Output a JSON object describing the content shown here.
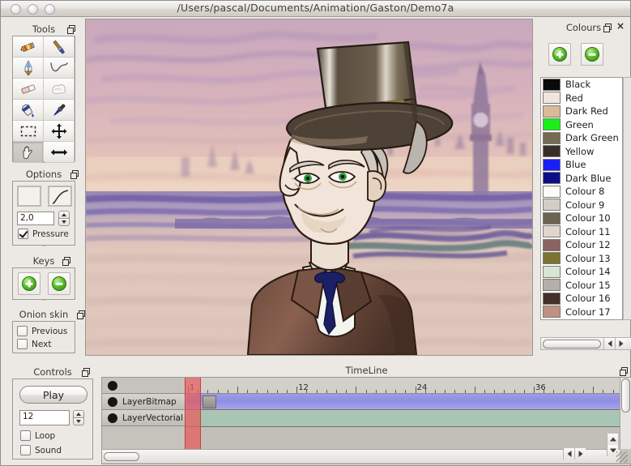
{
  "window": {
    "title": "/Users/pascal/Documents/Animation/Gaston/Demo7a",
    "traffic_lights": [
      "close",
      "minimize",
      "zoom"
    ]
  },
  "tools_palette": {
    "title": "Tools",
    "items": [
      {
        "name": "pencil-tool",
        "label": "Pencil",
        "selected": false
      },
      {
        "name": "brush-tool",
        "label": "Brush",
        "selected": false
      },
      {
        "name": "pen-tool",
        "label": "Pen",
        "selected": false
      },
      {
        "name": "polyline-tool",
        "label": "Polyline",
        "selected": false
      },
      {
        "name": "eraser-tool",
        "label": "Eraser",
        "selected": false
      },
      {
        "name": "smudge-tool",
        "label": "Smudge",
        "selected": false
      },
      {
        "name": "bucket-tool",
        "label": "Bucket",
        "selected": false
      },
      {
        "name": "eyedropper-tool",
        "label": "Eyedropper",
        "selected": false
      },
      {
        "name": "select-tool",
        "label": "Select",
        "selected": false
      },
      {
        "name": "move-tool",
        "label": "Move",
        "selected": false
      },
      {
        "name": "hand-tool",
        "label": "Hand",
        "selected": true
      },
      {
        "name": "resize-tool",
        "label": "Resize",
        "selected": false
      }
    ]
  },
  "options_palette": {
    "title": "Options",
    "color_swatch": "#000000",
    "curve_swatch": "#d7b340",
    "width_value": "2,0",
    "pressure_label": "Pressure",
    "pressure_checked": true
  },
  "keys_palette": {
    "title": "Keys",
    "add_label": "Add key",
    "remove_label": "Remove key"
  },
  "onion_palette": {
    "title": "Onion skin",
    "previous_label": "Previous",
    "previous_checked": false,
    "next_label": "Next",
    "next_checked": false
  },
  "controls_palette": {
    "title": "Controls",
    "play_label": "Play",
    "fps_value": "12",
    "loop_label": "Loop",
    "loop_checked": false,
    "sound_label": "Sound",
    "sound_checked": false
  },
  "colours_palette": {
    "title": "Colours",
    "add_label": "Add colour",
    "remove_label": "Remove colour",
    "swatches": [
      {
        "label": "Black",
        "hex": "#0a0a0a"
      },
      {
        "label": "Red",
        "hex": "#f0e6de"
      },
      {
        "label": "Dark Red",
        "hex": "#d9bb9a"
      },
      {
        "label": "Green",
        "hex": "#18f018"
      },
      {
        "label": "Dark Green",
        "hex": "#756b52"
      },
      {
        "label": "Yellow",
        "hex": "#362e29"
      },
      {
        "label": "Blue",
        "hex": "#1a20f5"
      },
      {
        "label": "Dark Blue",
        "hex": "#0a0f88"
      },
      {
        "label": "Colour 8",
        "hex": "#fbfaf7"
      },
      {
        "label": "Colour 9",
        "hex": "#d2cec6"
      },
      {
        "label": "Colour 10",
        "hex": "#6a6451"
      },
      {
        "label": "Colour 11",
        "hex": "#e2d5cd"
      },
      {
        "label": "Colour 12",
        "hex": "#8a6360"
      },
      {
        "label": "Colour 13",
        "hex": "#7b7331"
      },
      {
        "label": "Colour 14",
        "hex": "#d7e6d3"
      },
      {
        "label": "Colour 15",
        "hex": "#b3b0ab"
      },
      {
        "label": "Colour 16",
        "hex": "#44302c"
      },
      {
        "label": "Colour 17",
        "hex": "#bf9184"
      }
    ]
  },
  "timeline": {
    "title": "TimeLine",
    "frame_numbers": [
      "1",
      "12",
      "24",
      "36"
    ],
    "current_frame": 1,
    "layers": [
      {
        "name": "LayerBitmap",
        "color": "#9d9ce6",
        "has_keyframe": true
      },
      {
        "name": "LayerVectorial",
        "color": "#a9c5b4",
        "has_keyframe": false
      }
    ]
  }
}
